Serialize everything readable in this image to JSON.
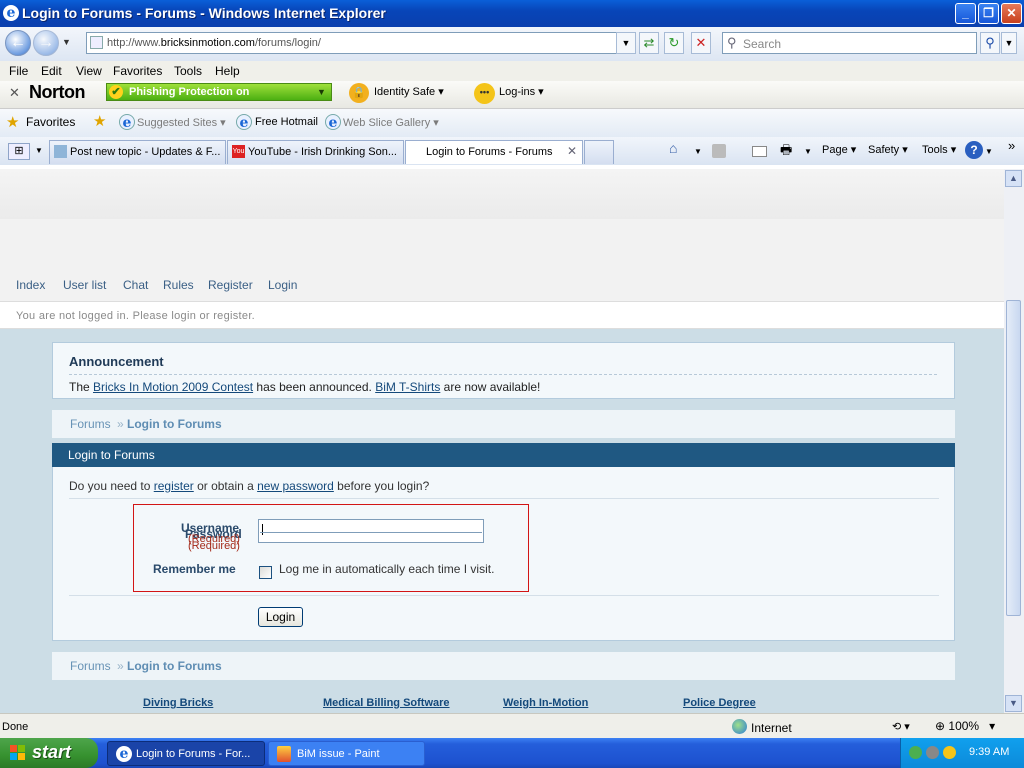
{
  "window": {
    "title": "Login to Forums - Forums - Windows Internet Explorer"
  },
  "address": {
    "url_prefix": "http://www.",
    "url_domain": "bricksinmotion.com",
    "url_path": "/forums/login/",
    "search_placeholder": "Search"
  },
  "menu": [
    "File",
    "Edit",
    "View",
    "Favorites",
    "Tools",
    "Help"
  ],
  "norton": {
    "brand": "Norton",
    "phishing": "Phishing Protection on",
    "identity": "Identity Safe",
    "logins": "Log-ins"
  },
  "favorites": {
    "label": "Favorites",
    "items": [
      "Suggested Sites",
      "Free Hotmail",
      "Web Slice Gallery"
    ]
  },
  "tabs": [
    "Post new topic - Updates & F...",
    "YouTube - Irish Drinking Son...",
    "Login to Forums - Forums"
  ],
  "commands": [
    "Page",
    "Safety",
    "Tools"
  ],
  "site": {
    "nav": [
      "Index",
      "User list",
      "Chat",
      "Rules",
      "Register",
      "Login"
    ],
    "status": "You are not logged in. Please login or register.",
    "announcement": {
      "title": "Announcement",
      "pre": "The ",
      "link1": "Bricks In Motion 2009 Contest",
      "mid": " has been announced. ",
      "link2": "BiM T-Shirts",
      "post": " are now available!"
    },
    "breadcrumb": {
      "root": "Forums",
      "sep": "»",
      "current": "Login to Forums"
    },
    "panel_title": "Login to Forums",
    "intro": {
      "pre": "Do you need to ",
      "link1": "register",
      "mid": " or obtain a ",
      "link2": "new password",
      "post": " before you login?"
    },
    "form": {
      "username": "Username",
      "password": "Password",
      "required": "(Required)",
      "remember": "Remember me",
      "remember_text": "Log me in automatically each time I visit.",
      "submit": "Login"
    },
    "ads": [
      "Diving Bricks",
      "Medical Billing Software",
      "Weigh In-Motion",
      "Police Degree"
    ]
  },
  "statusbar": {
    "left": "Done",
    "zone": "Internet",
    "zoom": "100%"
  },
  "taskbar": {
    "start": "start",
    "items": [
      "Login to Forums - For...",
      "BiM issue - Paint"
    ],
    "clock": "9:39 AM"
  }
}
